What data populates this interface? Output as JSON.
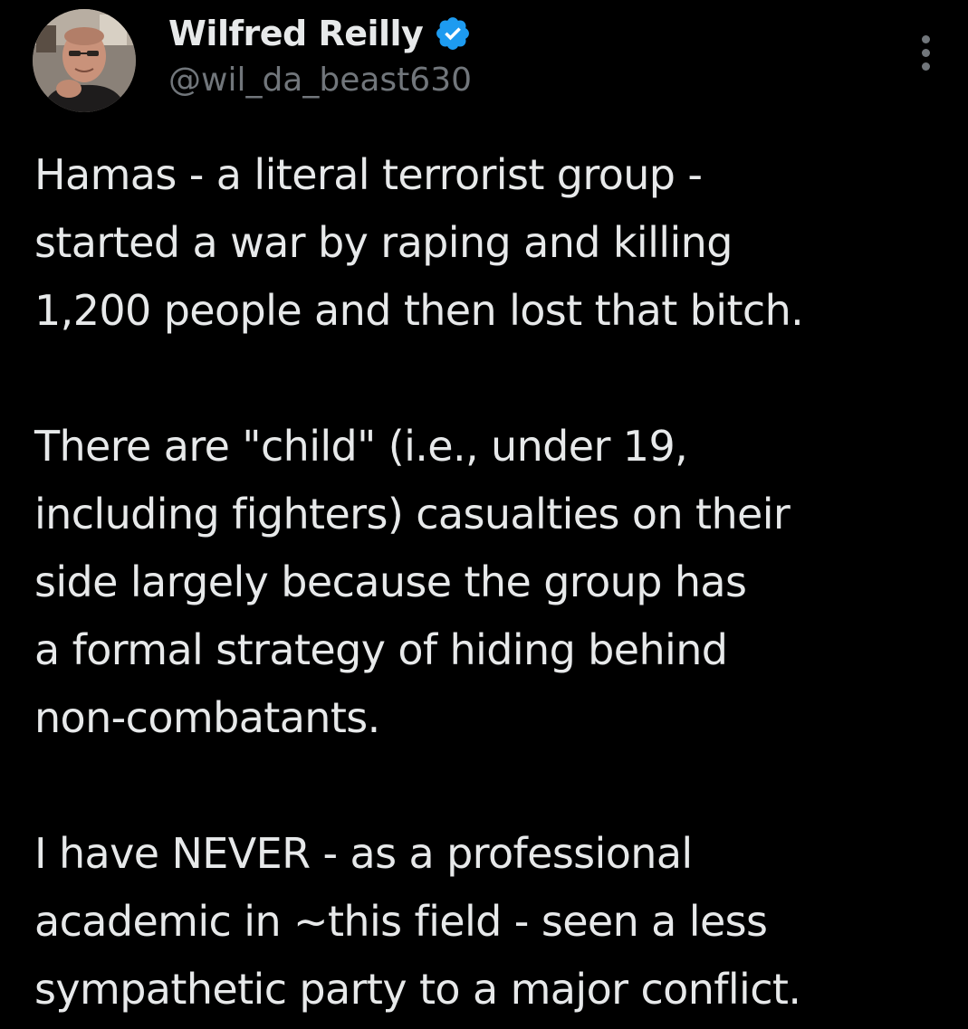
{
  "author": {
    "display_name": "Wilfred Reilly",
    "handle": "@wil_da_beast630",
    "verified": true,
    "avatar_icon": "profile-photo"
  },
  "more_icon": "ellipsis-vertical-icon",
  "colors": {
    "background": "#000000",
    "text_primary": "#e7e9ea",
    "text_secondary": "#71767b",
    "verified_badge": "#1d9bf0"
  },
  "tweet": {
    "paragraphs": [
      {
        "lines": [
          "Hamas - a literal terrorist group -",
          "started a war by raping and killing",
          "1,200 people and then lost that bitch."
        ]
      },
      {
        "lines": [
          "There are \"child\" (i.e., under 19,",
          "including fighters) casualties on their",
          "side largely because the group has",
          "a formal strategy of hiding behind",
          "non-combatants."
        ]
      },
      {
        "lines": [
          "I have NEVER - as a professional",
          "academic in ~this field - seen a less",
          "sympathetic party to a major conflict."
        ]
      }
    ]
  }
}
